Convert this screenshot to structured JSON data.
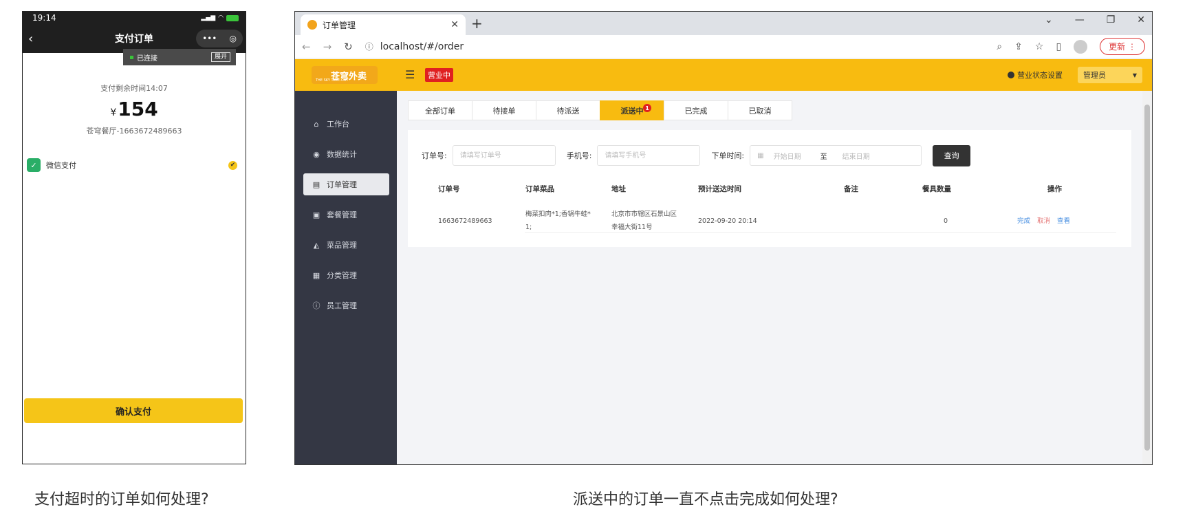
{
  "phone": {
    "time": "19:14",
    "nav_title": "支付订单",
    "connected": "已连接",
    "expand": "展开",
    "countdown": "支付剩余时间14:07",
    "currency": "¥",
    "amount": "154",
    "merchant": "苍穹餐厅-1663672489663",
    "method": "微信支付",
    "confirm": "确认支付"
  },
  "browser": {
    "tab_title": "订单管理",
    "url": "localhost/#/order",
    "update": "更新"
  },
  "app": {
    "logo": "苍穹外卖",
    "logo_sub": "THE SKY TAKE-OUT",
    "status": "营业中",
    "shop_setting": "营业状态设置",
    "user": "管理员",
    "sidebar": [
      {
        "label": "工作台",
        "icon": "⌂"
      },
      {
        "label": "数据统计",
        "icon": "◉"
      },
      {
        "label": "订单管理",
        "icon": "▤"
      },
      {
        "label": "套餐管理",
        "icon": "▣"
      },
      {
        "label": "菜品管理",
        "icon": "◭"
      },
      {
        "label": "分类管理",
        "icon": "▦"
      },
      {
        "label": "员工管理",
        "icon": "ⓘ"
      }
    ],
    "tabs": [
      "全部订单",
      "待接单",
      "待派送",
      "派送中",
      "已完成",
      "已取消"
    ],
    "active_tab_badge": "1",
    "search": {
      "order_label": "订单号:",
      "order_placeholder": "请填写订单号",
      "phone_label": "手机号:",
      "phone_placeholder": "请填写手机号",
      "time_label": "下单时间:",
      "start_placeholder": "开始日期",
      "to": "至",
      "end_placeholder": "结束日期",
      "button": "查询"
    },
    "table": {
      "headers": [
        "订单号",
        "订单菜品",
        "地址",
        "预计送达时间",
        "备注",
        "餐具数量",
        "操作"
      ],
      "row": {
        "order_no": "1663672489663",
        "dishes_l1": "梅菜扣肉*1;香锅牛蛙*",
        "dishes_l2": "1;",
        "addr_l1": "北京市市辖区石景山区",
        "addr_l2": "幸福大街11号",
        "eta": "2022-09-20 20:14",
        "note": "",
        "tableware": "0",
        "actions": [
          "完成",
          "取消",
          "查看"
        ]
      }
    }
  },
  "captions": {
    "left": "支付超时的订单如何处理?",
    "right": "派送中的订单一直不点击完成如何处理?"
  }
}
